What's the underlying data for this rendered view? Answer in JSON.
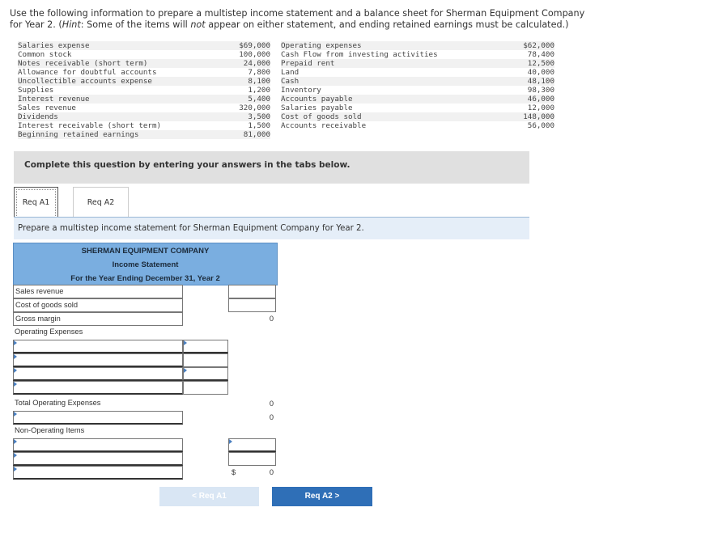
{
  "instructions": {
    "pre": "Use the following information to prepare a multistep income statement and a balance sheet for Sherman Equipment Company for Year 2. (",
    "hint_label": "Hint",
    "hint_pre": ": Some of the items will ",
    "not_word": "not",
    "hint_post": " appear on either statement, and ending retained earnings must be calculated.)"
  },
  "data_left": [
    {
      "label": "Salaries expense",
      "value": "$69,000"
    },
    {
      "label": "Common stock",
      "value": "100,000"
    },
    {
      "label": "Notes receivable (short term)",
      "value": "24,000"
    },
    {
      "label": "Allowance for doubtful accounts",
      "value": "7,800"
    },
    {
      "label": "Uncollectible accounts expense",
      "value": "8,100"
    },
    {
      "label": "Supplies",
      "value": "1,200"
    },
    {
      "label": "Interest revenue",
      "value": "5,400"
    },
    {
      "label": "Sales revenue",
      "value": "320,000"
    },
    {
      "label": "Dividends",
      "value": "3,500"
    },
    {
      "label": "Interest receivable (short term)",
      "value": "1,500"
    },
    {
      "label": "Beginning retained earnings",
      "value": "81,000"
    }
  ],
  "data_right": [
    {
      "label": "Operating expenses",
      "value": "$62,000"
    },
    {
      "label": "Cash Flow from investing activities",
      "value": "78,400"
    },
    {
      "label": "Prepaid rent",
      "value": "12,500"
    },
    {
      "label": "Land",
      "value": "40,000"
    },
    {
      "label": "Cash",
      "value": "48,100"
    },
    {
      "label": "Inventory",
      "value": "98,300"
    },
    {
      "label": "Accounts payable",
      "value": "46,000"
    },
    {
      "label": "Salaries payable",
      "value": "12,000"
    },
    {
      "label": "Cost of goods sold",
      "value": "148,000"
    },
    {
      "label": "Accounts receivable",
      "value": "56,000"
    }
  ],
  "complete_text": "Complete this question by entering your answers in the tabs below.",
  "tabs": [
    {
      "label": "Req A1"
    },
    {
      "label": "Req A2"
    }
  ],
  "prepare_text": "Prepare a multistep income statement for Sherman Equipment Company for Year 2.",
  "statement": {
    "company": "SHERMAN EQUIPMENT COMPANY",
    "title": "Income Statement",
    "period": "For the Year Ending December 31, Year 2",
    "sales_revenue": "Sales revenue",
    "cogs": "Cost of goods sold",
    "gross_margin": "Gross margin",
    "gross_margin_value": "0",
    "operating_expenses": "Operating Expenses",
    "total_operating": "Total Operating Expenses",
    "total_operating_value": "0",
    "operating_income_value": "0",
    "non_operating": "Non-Operating Items",
    "dollar": "$",
    "net_value": "0"
  },
  "nav": {
    "prev": "Req A1",
    "next": "Req A2",
    "prev_arrow": "<",
    "next_arrow": ">"
  }
}
